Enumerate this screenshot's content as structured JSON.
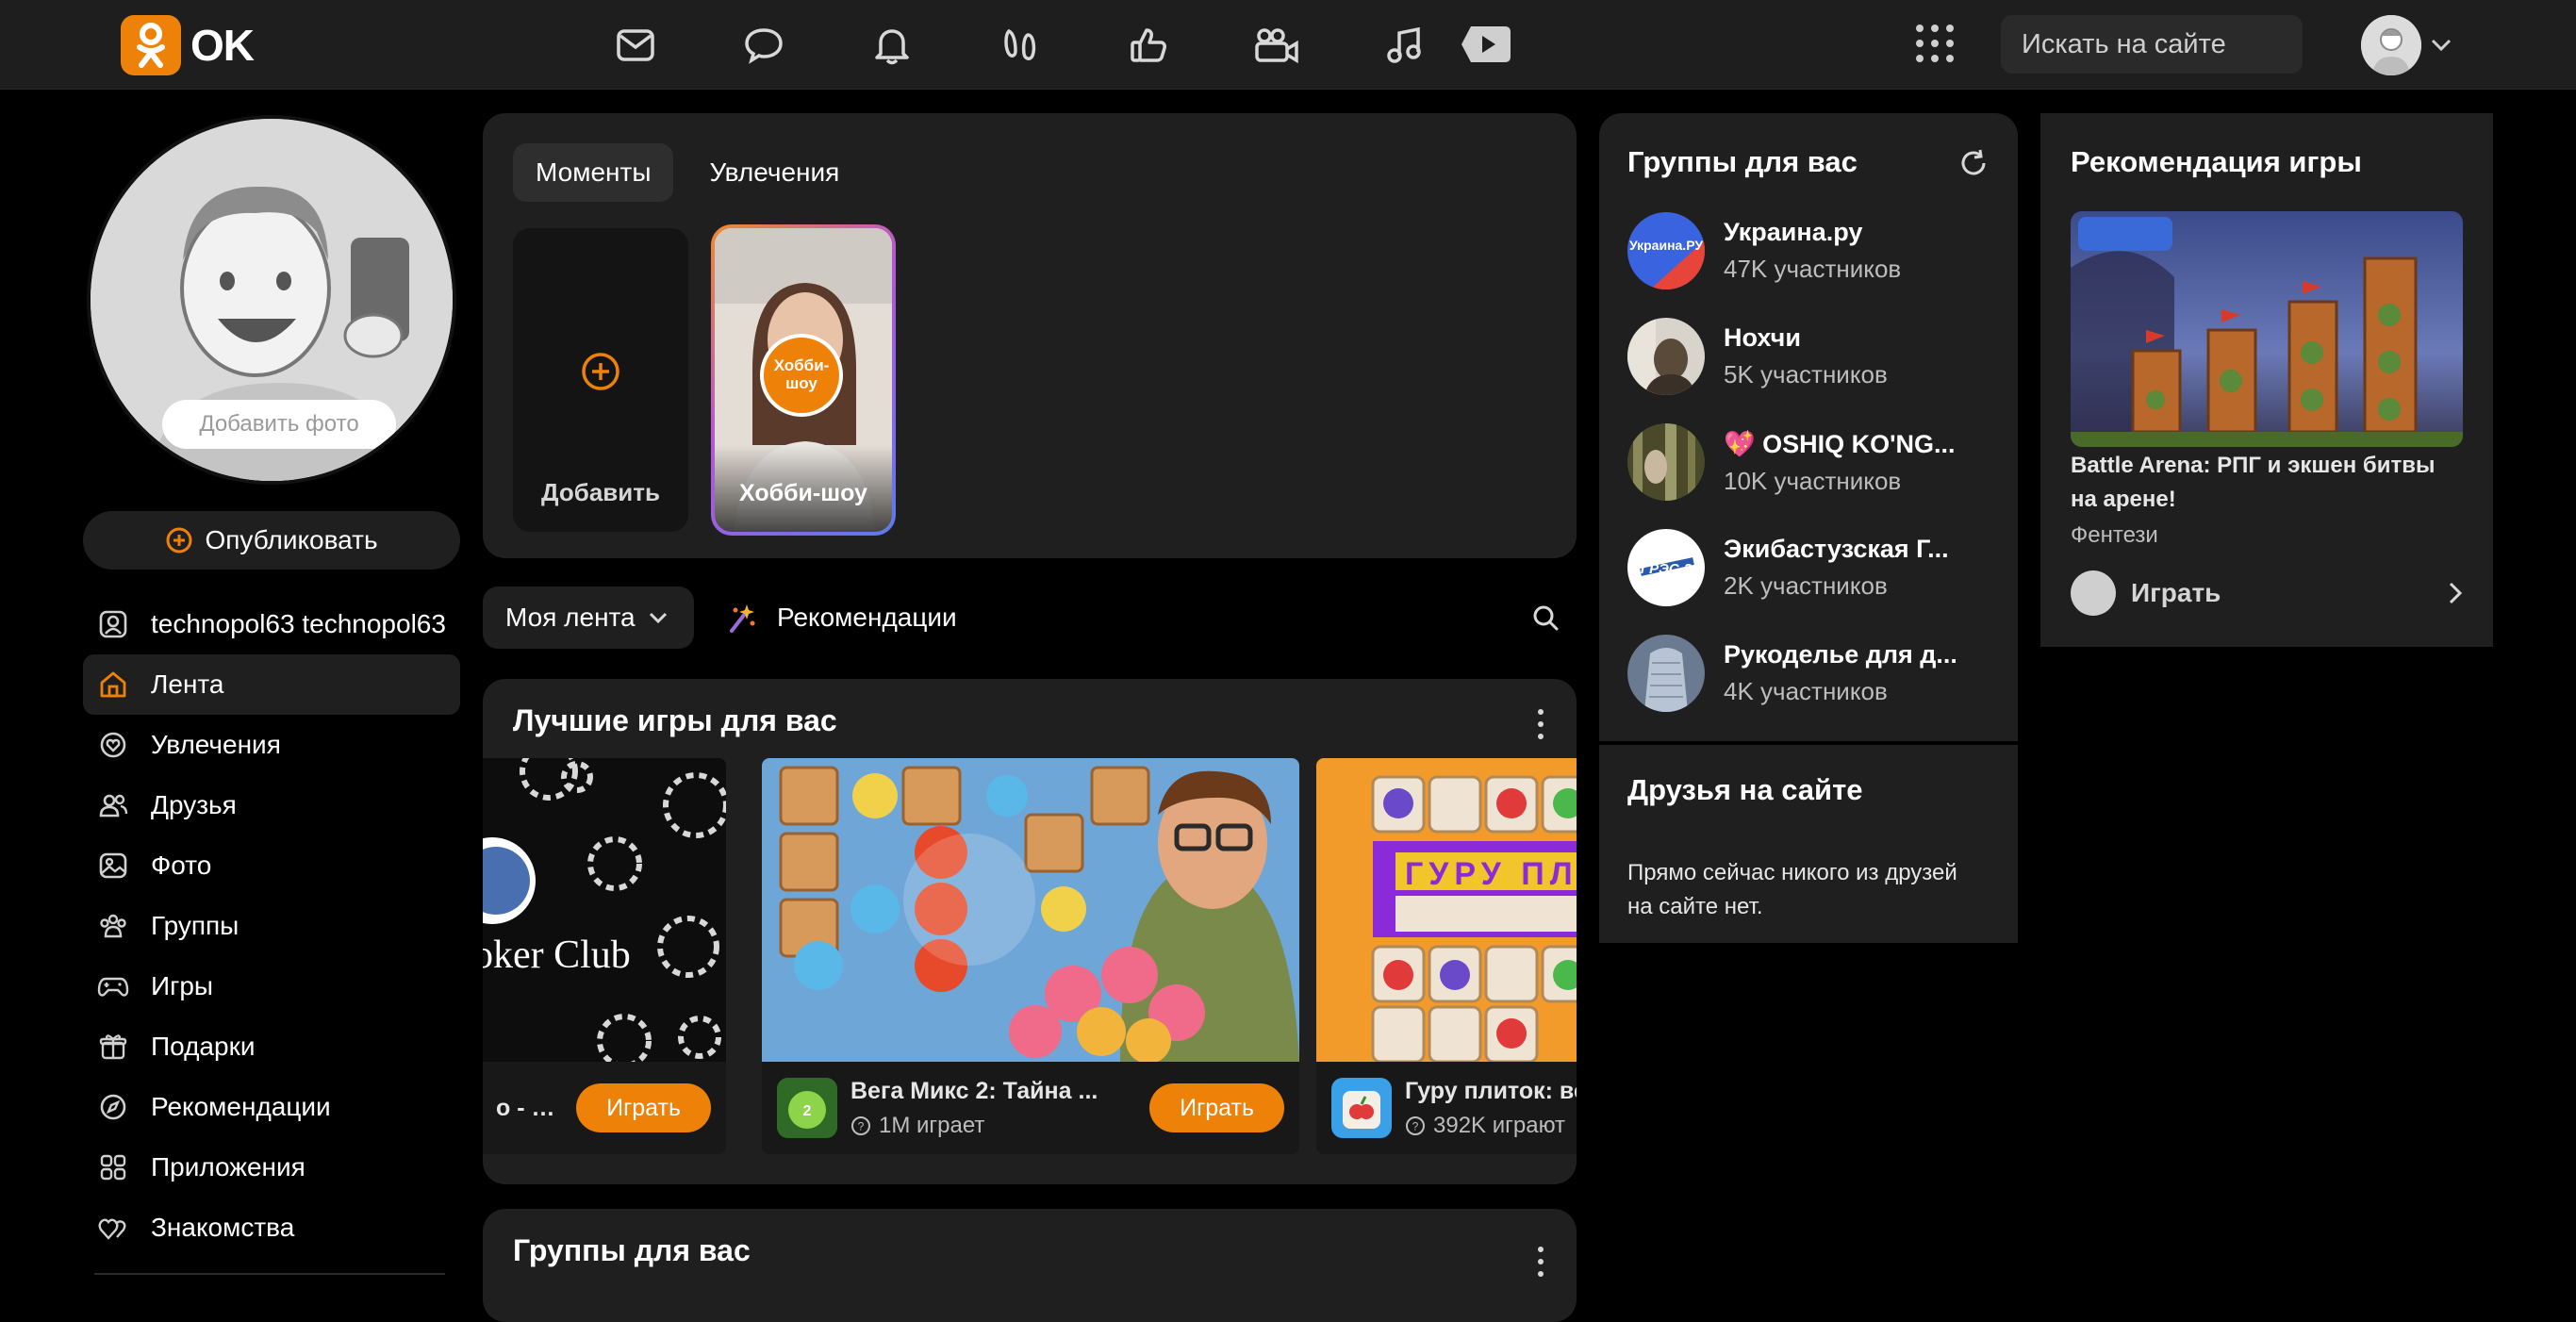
{
  "header": {
    "logo_text": "OK",
    "nav_icons": [
      "mail-icon",
      "chat-icon",
      "bell-icon",
      "guests-icon",
      "like-icon",
      "video-icon",
      "music-icon",
      "play-icon"
    ],
    "search_placeholder": "Искать на сайте",
    "accent_color": "#ee8208"
  },
  "sidebar": {
    "add_photo": "Добавить фото",
    "publish": "Опубликовать",
    "items": [
      {
        "label": "technopol63 technopol63",
        "icon": "profile-icon"
      },
      {
        "label": "Лента",
        "icon": "home-icon",
        "active": true
      },
      {
        "label": "Увлечения",
        "icon": "hobby-icon"
      },
      {
        "label": "Друзья",
        "icon": "friends-icon"
      },
      {
        "label": "Фото",
        "icon": "photo-icon"
      },
      {
        "label": "Группы",
        "icon": "groups-icon"
      },
      {
        "label": "Игры",
        "icon": "gamepad-icon"
      },
      {
        "label": "Подарки",
        "icon": "gift-icon"
      },
      {
        "label": "Рекомендации",
        "icon": "compass-icon"
      },
      {
        "label": "Приложения",
        "icon": "apps-icon"
      },
      {
        "label": "Знакомства",
        "icon": "dating-icon"
      }
    ]
  },
  "moments": {
    "tabs": [
      "Моменты",
      "Увлечения"
    ],
    "add_label": "Добавить",
    "story": {
      "badge": "Хобби-шоу",
      "title": "Хобби-шоу"
    }
  },
  "feed": {
    "selector": "Моя лента",
    "recommendations": "Рекомендации"
  },
  "games_section": {
    "title": "Лучшие игры для вас",
    "games": [
      {
        "name": "о - П...",
        "players": "",
        "play": "Играть",
        "image_text": "oker Club"
      },
      {
        "name": "Вега Микс 2: Тайна ...",
        "players": "1M играет",
        "play": "Играть"
      },
      {
        "name": "Гуру плиток: ве",
        "players": "392K играют",
        "play": "",
        "image_text": "ГУРУ ПЛИТ"
      }
    ]
  },
  "groups_feed": {
    "title": "Группы для вас"
  },
  "groups_panel": {
    "title": "Группы для вас",
    "groups": [
      {
        "name": "Украина.ру",
        "count": "47K участников",
        "avatar_text": "Украина.РУ"
      },
      {
        "name": "Нохчи",
        "count": "5K участников"
      },
      {
        "name": "💖 OSHIQ KO'NG...",
        "count": "10K участников"
      },
      {
        "name": "Экибастузская Г...",
        "count": "2K участников",
        "avatar_text": "ГРЭС-2"
      },
      {
        "name": "Рукоделье для д...",
        "count": "4K участников"
      }
    ],
    "friends_title": "Друзья на сайте",
    "friends_text": "Прямо сейчас никого из друзей на сайте нет."
  },
  "game_rec": {
    "title": "Рекомендация игры",
    "name": "Battle Arena: РПГ и экшен битвы на арене!",
    "genre": "Фентези",
    "play": "Играть"
  }
}
